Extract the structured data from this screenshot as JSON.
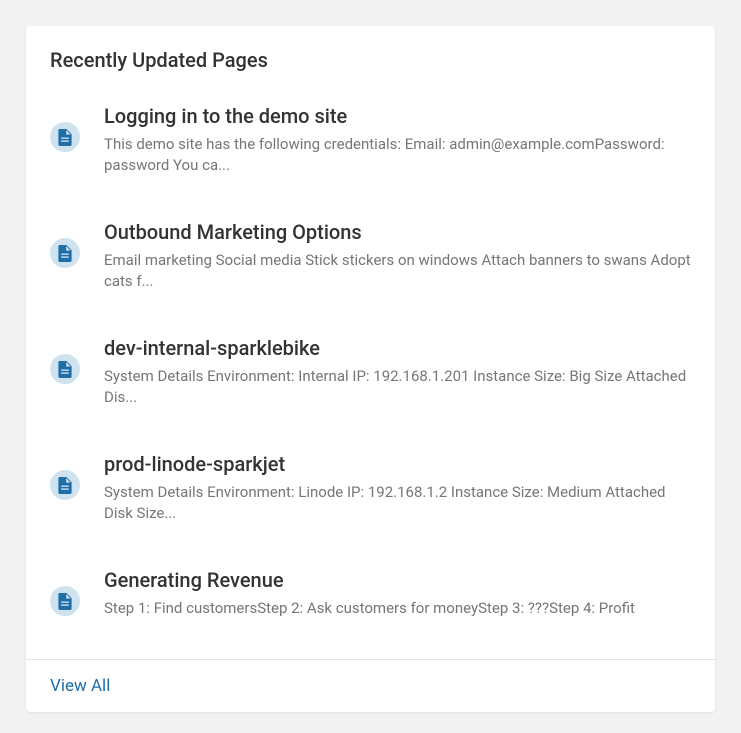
{
  "header": {
    "title": "Recently Updated Pages"
  },
  "items": [
    {
      "title": "Logging in to the demo site",
      "desc": "This demo site has the following credentials: Email: admin@example.comPassword: password You ca..."
    },
    {
      "title": "Outbound Marketing Options",
      "desc": "Email marketing Social media Stick stickers on windows Attach banners to swans Adopt cats f..."
    },
    {
      "title": "dev-internal-sparklebike",
      "desc": "System Details Environment: Internal IP: 192.168.1.201 Instance Size: Big Size Attached Dis..."
    },
    {
      "title": "prod-linode-sparkjet",
      "desc": "System Details Environment: Linode IP: 192.168.1.2 Instance Size: Medium Attached Disk Size..."
    },
    {
      "title": "Generating Revenue",
      "desc": "Step 1: Find customersStep 2: Ask customers for moneyStep 3: ???Step 4: Profit"
    }
  ],
  "footer": {
    "viewAll": "View All"
  }
}
